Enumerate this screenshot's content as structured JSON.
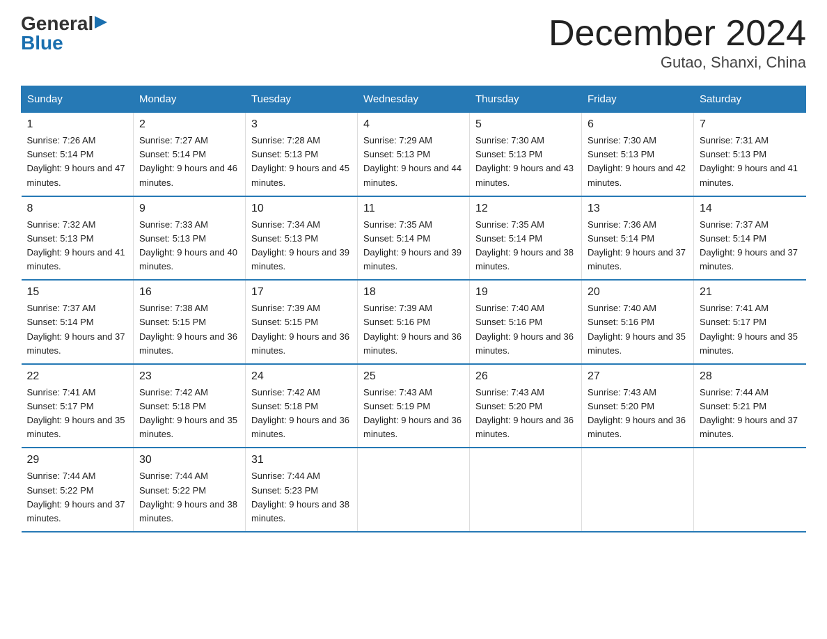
{
  "header": {
    "logo": {
      "general": "General",
      "blue": "Blue",
      "triangle": "▶"
    },
    "title": "December 2024",
    "subtitle": "Gutao, Shanxi, China"
  },
  "days_of_week": [
    "Sunday",
    "Monday",
    "Tuesday",
    "Wednesday",
    "Thursday",
    "Friday",
    "Saturday"
  ],
  "weeks": [
    [
      {
        "num": "1",
        "sunrise": "7:26 AM",
        "sunset": "5:14 PM",
        "daylight": "9 hours and 47 minutes."
      },
      {
        "num": "2",
        "sunrise": "7:27 AM",
        "sunset": "5:14 PM",
        "daylight": "9 hours and 46 minutes."
      },
      {
        "num": "3",
        "sunrise": "7:28 AM",
        "sunset": "5:13 PM",
        "daylight": "9 hours and 45 minutes."
      },
      {
        "num": "4",
        "sunrise": "7:29 AM",
        "sunset": "5:13 PM",
        "daylight": "9 hours and 44 minutes."
      },
      {
        "num": "5",
        "sunrise": "7:30 AM",
        "sunset": "5:13 PM",
        "daylight": "9 hours and 43 minutes."
      },
      {
        "num": "6",
        "sunrise": "7:30 AM",
        "sunset": "5:13 PM",
        "daylight": "9 hours and 42 minutes."
      },
      {
        "num": "7",
        "sunrise": "7:31 AM",
        "sunset": "5:13 PM",
        "daylight": "9 hours and 41 minutes."
      }
    ],
    [
      {
        "num": "8",
        "sunrise": "7:32 AM",
        "sunset": "5:13 PM",
        "daylight": "9 hours and 41 minutes."
      },
      {
        "num": "9",
        "sunrise": "7:33 AM",
        "sunset": "5:13 PM",
        "daylight": "9 hours and 40 minutes."
      },
      {
        "num": "10",
        "sunrise": "7:34 AM",
        "sunset": "5:13 PM",
        "daylight": "9 hours and 39 minutes."
      },
      {
        "num": "11",
        "sunrise": "7:35 AM",
        "sunset": "5:14 PM",
        "daylight": "9 hours and 39 minutes."
      },
      {
        "num": "12",
        "sunrise": "7:35 AM",
        "sunset": "5:14 PM",
        "daylight": "9 hours and 38 minutes."
      },
      {
        "num": "13",
        "sunrise": "7:36 AM",
        "sunset": "5:14 PM",
        "daylight": "9 hours and 37 minutes."
      },
      {
        "num": "14",
        "sunrise": "7:37 AM",
        "sunset": "5:14 PM",
        "daylight": "9 hours and 37 minutes."
      }
    ],
    [
      {
        "num": "15",
        "sunrise": "7:37 AM",
        "sunset": "5:14 PM",
        "daylight": "9 hours and 37 minutes."
      },
      {
        "num": "16",
        "sunrise": "7:38 AM",
        "sunset": "5:15 PM",
        "daylight": "9 hours and 36 minutes."
      },
      {
        "num": "17",
        "sunrise": "7:39 AM",
        "sunset": "5:15 PM",
        "daylight": "9 hours and 36 minutes."
      },
      {
        "num": "18",
        "sunrise": "7:39 AM",
        "sunset": "5:16 PM",
        "daylight": "9 hours and 36 minutes."
      },
      {
        "num": "19",
        "sunrise": "7:40 AM",
        "sunset": "5:16 PM",
        "daylight": "9 hours and 36 minutes."
      },
      {
        "num": "20",
        "sunrise": "7:40 AM",
        "sunset": "5:16 PM",
        "daylight": "9 hours and 35 minutes."
      },
      {
        "num": "21",
        "sunrise": "7:41 AM",
        "sunset": "5:17 PM",
        "daylight": "9 hours and 35 minutes."
      }
    ],
    [
      {
        "num": "22",
        "sunrise": "7:41 AM",
        "sunset": "5:17 PM",
        "daylight": "9 hours and 35 minutes."
      },
      {
        "num": "23",
        "sunrise": "7:42 AM",
        "sunset": "5:18 PM",
        "daylight": "9 hours and 35 minutes."
      },
      {
        "num": "24",
        "sunrise": "7:42 AM",
        "sunset": "5:18 PM",
        "daylight": "9 hours and 36 minutes."
      },
      {
        "num": "25",
        "sunrise": "7:43 AM",
        "sunset": "5:19 PM",
        "daylight": "9 hours and 36 minutes."
      },
      {
        "num": "26",
        "sunrise": "7:43 AM",
        "sunset": "5:20 PM",
        "daylight": "9 hours and 36 minutes."
      },
      {
        "num": "27",
        "sunrise": "7:43 AM",
        "sunset": "5:20 PM",
        "daylight": "9 hours and 36 minutes."
      },
      {
        "num": "28",
        "sunrise": "7:44 AM",
        "sunset": "5:21 PM",
        "daylight": "9 hours and 37 minutes."
      }
    ],
    [
      {
        "num": "29",
        "sunrise": "7:44 AM",
        "sunset": "5:22 PM",
        "daylight": "9 hours and 37 minutes."
      },
      {
        "num": "30",
        "sunrise": "7:44 AM",
        "sunset": "5:22 PM",
        "daylight": "9 hours and 38 minutes."
      },
      {
        "num": "31",
        "sunrise": "7:44 AM",
        "sunset": "5:23 PM",
        "daylight": "9 hours and 38 minutes."
      },
      null,
      null,
      null,
      null
    ]
  ],
  "labels": {
    "sunrise": "Sunrise:",
    "sunset": "Sunset:",
    "daylight": "Daylight:"
  }
}
